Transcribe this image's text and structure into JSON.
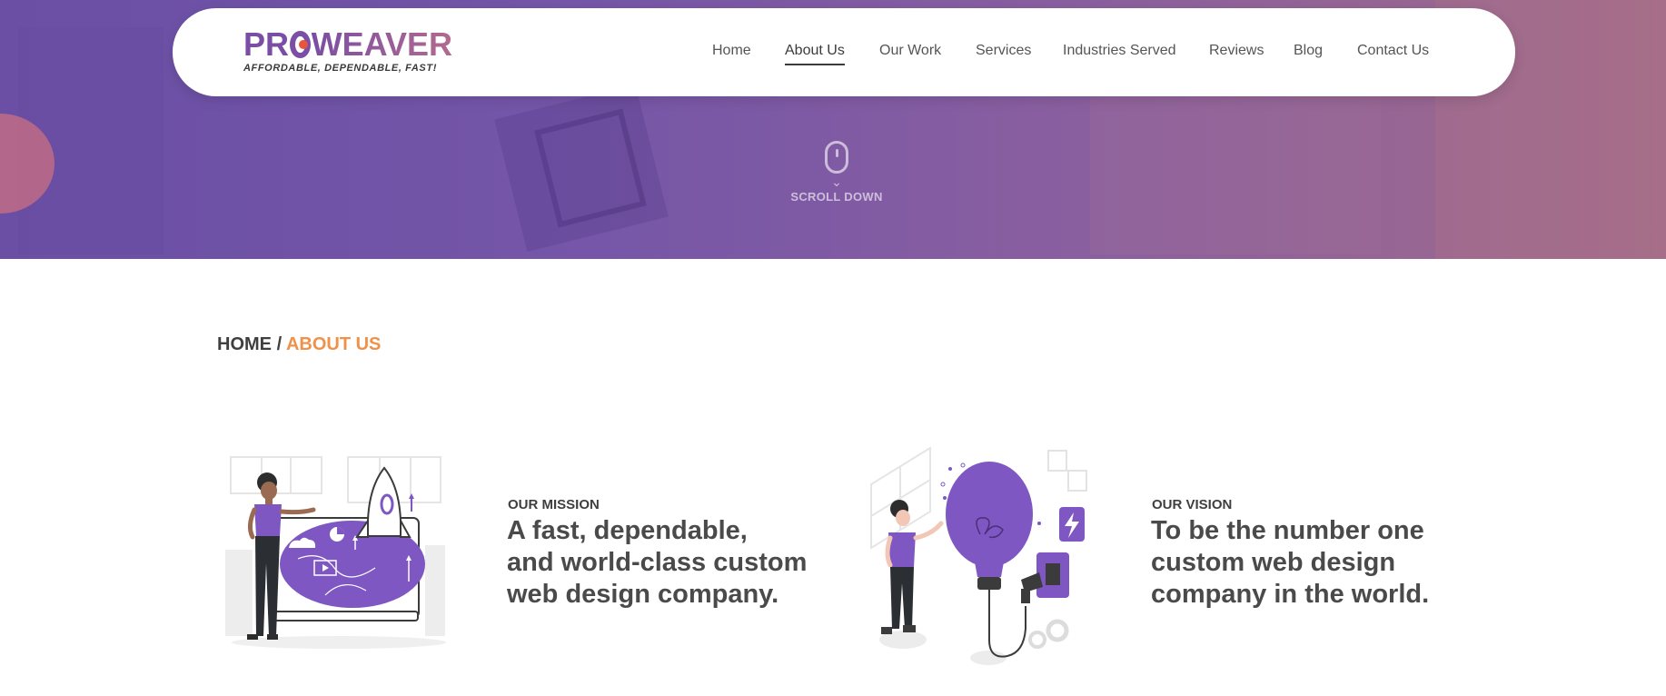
{
  "brand": {
    "logo_text_1": "PR",
    "logo_text_2": "WEAVER",
    "tagline": "AFFORDABLE, DEPENDABLE, FAST!",
    "primary_color": "#6b48a6",
    "accent_color": "#f0914a"
  },
  "nav": {
    "items": [
      {
        "label": "Home"
      },
      {
        "label": "About Us",
        "active": true
      },
      {
        "label": "Our Work"
      },
      {
        "label": "Services"
      },
      {
        "label": "Industries Served"
      },
      {
        "label": "Reviews"
      },
      {
        "label": "Blog"
      },
      {
        "label": "Contact Us"
      }
    ]
  },
  "hero": {
    "scroll_label": "SCROLL DOWN"
  },
  "breadcrumb": {
    "home": "HOME",
    "separator": "/",
    "current": "ABOUT US"
  },
  "mission": {
    "eyebrow": "OUR MISSION",
    "line1": "A fast, dependable,",
    "line2": "and world-class custom",
    "line3": "web design company.",
    "illustration": "woman-rocket-screen-illustration"
  },
  "vision": {
    "eyebrow": "OUR VISION",
    "line1": "To be the number one",
    "line2": "custom web design",
    "line3": "company in the world.",
    "illustration": "woman-lightbulb-plug-illustration"
  }
}
